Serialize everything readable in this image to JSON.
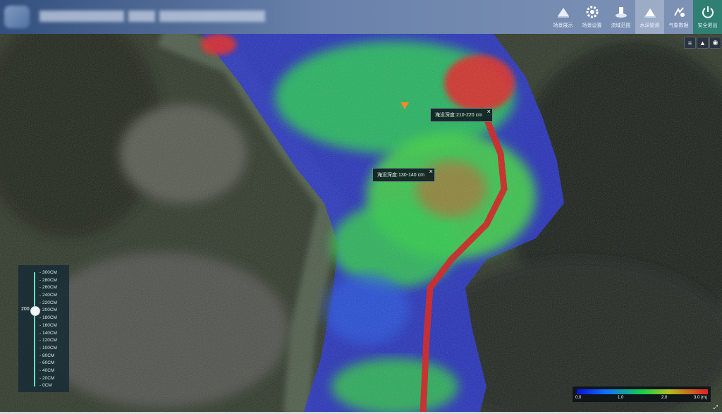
{
  "header": {
    "nav": [
      {
        "label": "场景展示",
        "icon": "mountain-icon"
      },
      {
        "label": "场景设置",
        "icon": "gear-icon"
      },
      {
        "label": "流域范围",
        "icon": "basin-icon"
      },
      {
        "label": "水深监测",
        "icon": "water-depth-icon",
        "active": true
      },
      {
        "label": "气象数据",
        "icon": "weather-icon"
      },
      {
        "label": "安全退出",
        "icon": "exit-icon"
      }
    ]
  },
  "popups": [
    {
      "text": "淹没深度:210-220 cm"
    },
    {
      "text": "淹没深度:130-140 cm"
    }
  ],
  "depth_slider": {
    "value": "200",
    "value_cm": 200,
    "ticks": [
      "300CM",
      "280CM",
      "260CM",
      "240CM",
      "220CM",
      "200CM",
      "180CM",
      "160CM",
      "140CM",
      "120CM",
      "100CM",
      "80CM",
      "60CM",
      "40CM",
      "20CM",
      "0CM"
    ]
  },
  "legend": {
    "labels": [
      "0.0",
      "1.0",
      "2.0",
      "3.0 (m)"
    ],
    "colors": [
      "#0a10d8",
      "#14d04a",
      "#e02020"
    ]
  }
}
